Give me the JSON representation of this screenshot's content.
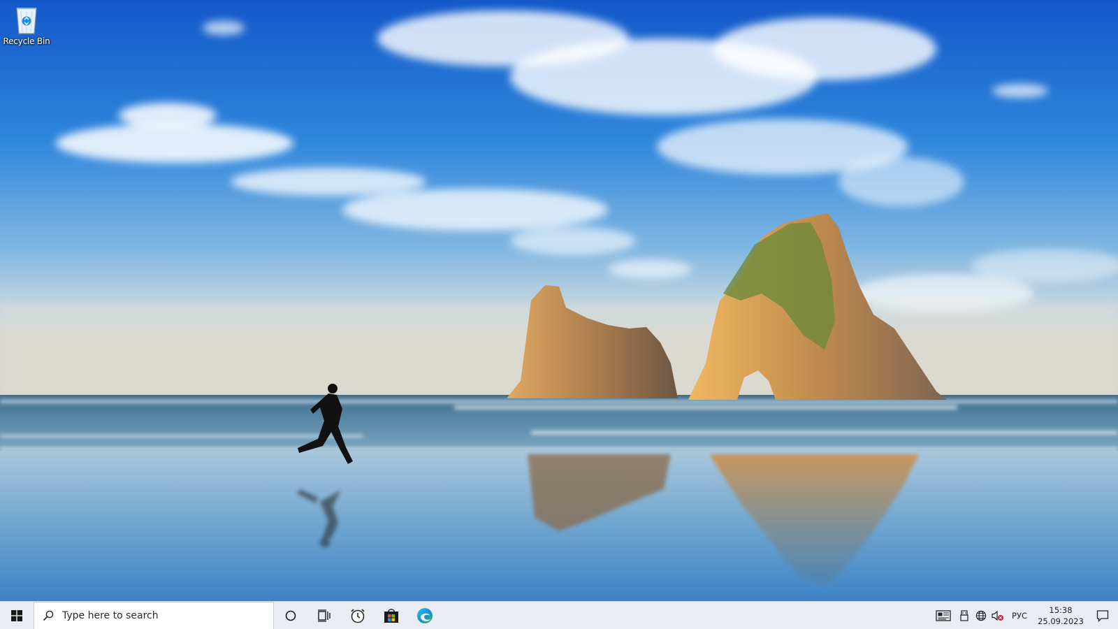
{
  "desktop": {
    "icons": [
      {
        "label": "Recycle Bin",
        "icon": "recycle-bin-icon"
      }
    ]
  },
  "taskbar": {
    "start_icon": "windows-logo-icon",
    "search": {
      "placeholder": "Type here to search",
      "icon": "search-icon"
    },
    "pinned": [
      {
        "icon": "cortana-icon"
      },
      {
        "icon": "task-view-icon"
      },
      {
        "icon": "alarms-clock-icon"
      },
      {
        "icon": "microsoft-store-icon"
      },
      {
        "icon": "edge-icon"
      }
    ],
    "tray": {
      "icons": [
        "news-widget-icon",
        "usb-device-icon",
        "network-globe-icon",
        "volume-muted-icon"
      ],
      "language": "РУС",
      "time": "15:38",
      "date": "25.09.2023",
      "notification_icon": "action-center-icon"
    }
  },
  "colors": {
    "taskbar_bg": "#e9edf3",
    "accent_blue": "#0078d7"
  }
}
